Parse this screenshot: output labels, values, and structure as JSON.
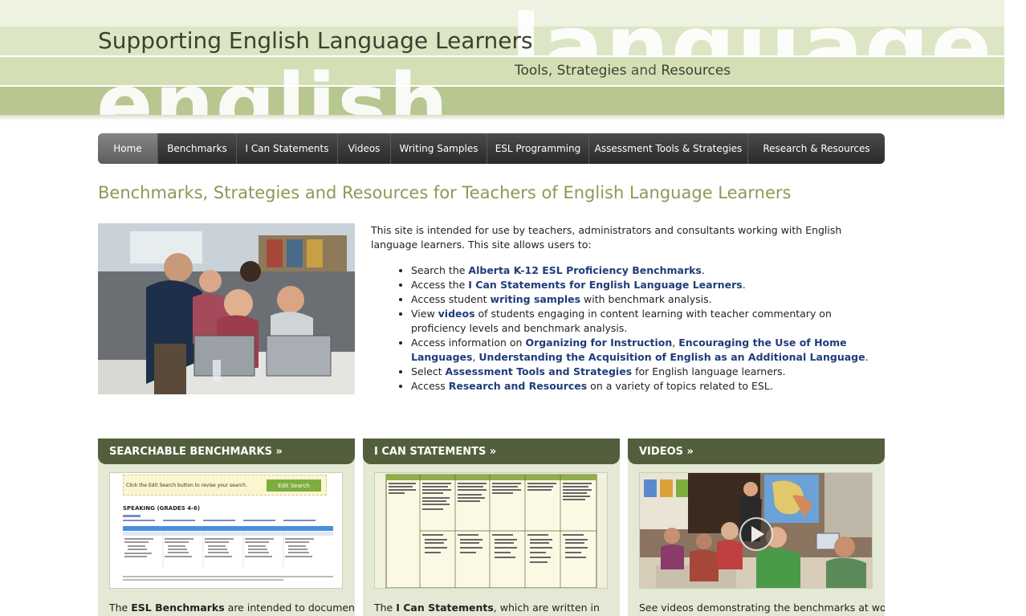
{
  "header": {
    "title": "Supporting English Language Learners",
    "tagline_part1": "Tools, Strategies",
    "tagline_and": " and ",
    "tagline_part2": "Resources",
    "big_word_1": "language",
    "big_word_2": "english"
  },
  "nav": {
    "items": [
      {
        "label": "Home"
      },
      {
        "label": "Benchmarks"
      },
      {
        "label": "I Can Statements"
      },
      {
        "label": "Videos"
      },
      {
        "label": "Writing Samples"
      },
      {
        "label": "ESL Programming"
      },
      {
        "label": "Assessment Tools & Strategies"
      },
      {
        "label": "Research & Resources"
      }
    ]
  },
  "main": {
    "heading": "Benchmarks, Strategies and Resources for Teachers of English Language Learners",
    "intro": "This site is intended for use by teachers, administrators and consultants working with English language learners. This site allows users to:",
    "list": {
      "i0": {
        "pre": "Search the ",
        "link": "Alberta K-12 ESL Proficiency Benchmarks",
        "post": "."
      },
      "i1": {
        "pre": "Access the ",
        "link": "I Can Statements for English Language Learners",
        "post": "."
      },
      "i2": {
        "pre": "Access student ",
        "link": "writing samples",
        "post": " with benchmark analysis."
      },
      "i3": {
        "pre": "View ",
        "link": "videos",
        "post": " of students engaging in content learning with teacher commentary on proficiency levels and benchmark analysis."
      },
      "i4": {
        "pre": "Access information on ",
        "link1": "Organizing for Instruction",
        "sep1": ", ",
        "link2": "Encouraging the Use of Home Languages",
        "sep2": ", ",
        "link3": "Understanding the Acquisition of English as an Additional Language",
        "post": "."
      },
      "i5": {
        "pre": "Select ",
        "link": "Assessment Tools and Strategies",
        "post": " for English language learners."
      },
      "i6": {
        "pre": "Access ",
        "link": "Research and Resources",
        "post": " on a variety of topics related to ESL."
      }
    }
  },
  "cards": {
    "benchmarks": {
      "title": "SEARCHABLE BENCHMARKS »",
      "text_pre": "The ",
      "text_bold": "ESL Benchmarks",
      "text_post": " are intended to document",
      "thumb_hint": "Click the Edit Search button to revise your search.",
      "thumb_button": "Edit Search",
      "thumb_heading": "SPEAKING (GRADES 4-6)"
    },
    "ican": {
      "title": "I CAN STATEMENTS »",
      "text_pre": "The ",
      "text_bold": "I Can Statements",
      "text_post": ", which are written in"
    },
    "videos": {
      "title": "VIDEOS »",
      "text": "See videos demonstrating the benchmarks at work"
    }
  },
  "colors": {
    "heading": "#8a9a55",
    "card_head": "#535f3c",
    "link": "#1f3d7a",
    "banner_dark_band": "#b8c68f"
  },
  "icons": {
    "video_play": "play-icon"
  }
}
